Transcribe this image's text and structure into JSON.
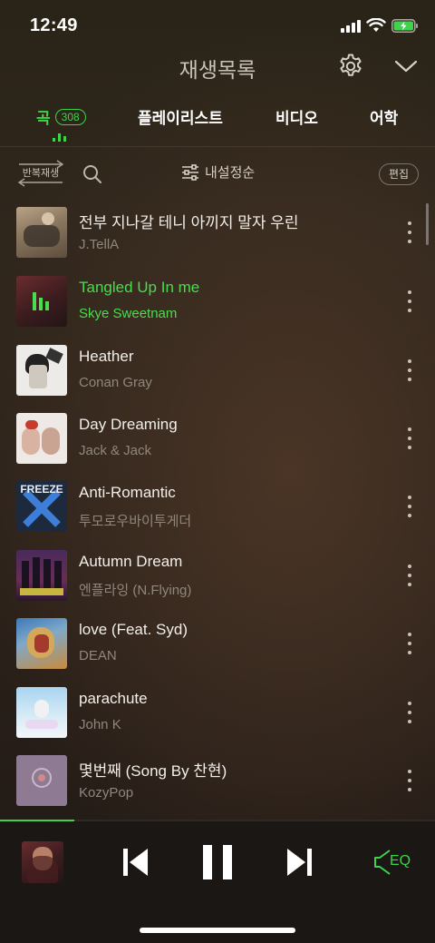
{
  "status": {
    "time": "12:49"
  },
  "header": {
    "title": "재생목록"
  },
  "tabs": [
    {
      "label": "곡",
      "count": "308",
      "active": true
    },
    {
      "label": "플레이리스트"
    },
    {
      "label": "비디오"
    },
    {
      "label": "어학"
    }
  ],
  "toolbar": {
    "repeat_label": "반복재생",
    "sort_label": "내설정순",
    "edit_label": "편집"
  },
  "songs": [
    {
      "title": "전부 지나갈 테니 아끼지 말자 우린",
      "artist": "J.TellA"
    },
    {
      "title": "Tangled Up In me",
      "artist": "Skye Sweetnam",
      "playing": true
    },
    {
      "title": "Heather",
      "artist": "Conan Gray"
    },
    {
      "title": "Day Dreaming",
      "artist": "Jack & Jack"
    },
    {
      "title": "Anti-Romantic",
      "artist": "투모로우바이투게더",
      "art_text": "FREEZE"
    },
    {
      "title": "Autumn Dream",
      "artist": "엔플라잉 (N.Flying)"
    },
    {
      "title": "love (Feat. Syd)",
      "artist": "DEAN"
    },
    {
      "title": "parachute",
      "artist": "John K"
    },
    {
      "title": "몇번째 (Song By 찬현)",
      "artist": "KozyPop"
    }
  ],
  "player": {
    "eq_label": "EQ",
    "progress": 0.17
  },
  "colors": {
    "accent": "#3ed34a",
    "secondary_text": "#8f877d"
  }
}
